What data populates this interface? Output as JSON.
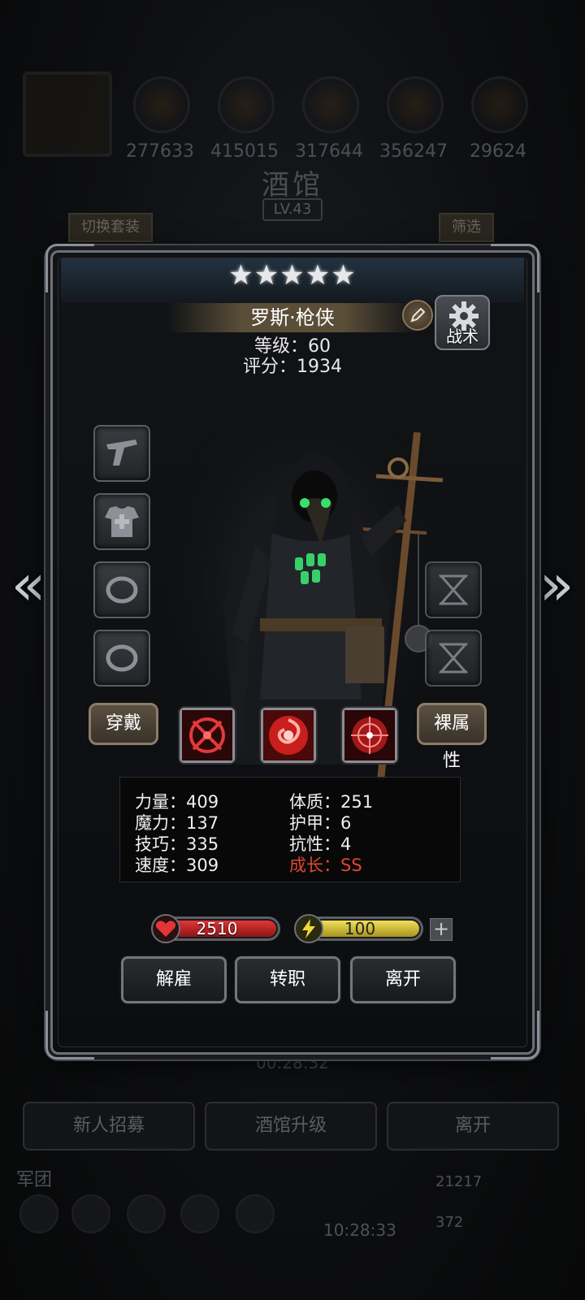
{
  "background": {
    "resources": [
      "277633",
      "415015",
      "317644",
      "356247",
      "29624"
    ],
    "title": "酒馆",
    "level": "LV.43",
    "switch_set_label": "切换套装",
    "filter_label": "筛选",
    "timer": "00:28:32",
    "bottom_buttons": [
      "新人招募",
      "酒馆升级",
      "离开"
    ],
    "corps_label": "军团",
    "gold": "21217",
    "gems": "372",
    "clock": "10:28:33"
  },
  "hero": {
    "stars": "★★★★★",
    "name": "罗斯·枪侠",
    "level": "等级：60",
    "score": "评分：1934",
    "tactics_label": "战术"
  },
  "equipment": {
    "wear_label": "穿戴",
    "naked_attr_label": "裸属性",
    "slots_left": [
      "pistol-icon",
      "armor-icon",
      "ring-icon",
      "ring-icon"
    ],
    "slots_right": [
      "hourglass-icon",
      "hourglass-icon"
    ]
  },
  "stats": {
    "strength": "力量：409",
    "magic": "魔力：137",
    "skill": "技巧：335",
    "speed": "速度：309",
    "constitution": "体质：251",
    "armor": "护甲：6",
    "resistance": "抗性：4",
    "growth": "成长：SS"
  },
  "bars": {
    "hp": "2510",
    "energy": "100"
  },
  "actions": {
    "dismiss": "解雇",
    "change_job": "转职",
    "leave": "离开"
  },
  "colors": {
    "hp": "#c0201f",
    "energy": "#d6c234",
    "growth": "#e0462f"
  }
}
